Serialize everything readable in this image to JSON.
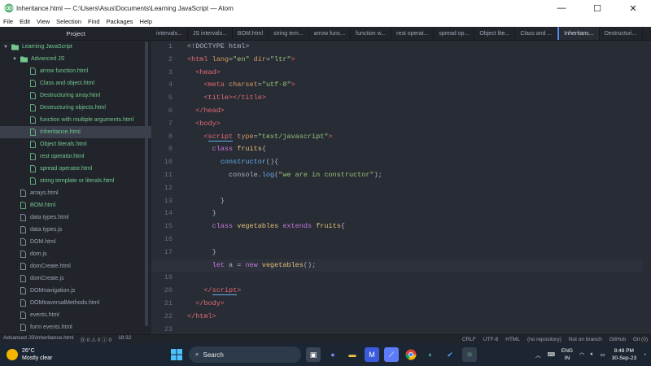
{
  "window": {
    "title": "Inheritance.html — C:\\Users\\Asus\\Documents\\Learning JavaScript — Atom",
    "min": "—",
    "max": "☐",
    "close": "✕"
  },
  "menu": [
    "File",
    "Edit",
    "View",
    "Selection",
    "Find",
    "Packages",
    "Help"
  ],
  "project": {
    "header": "Project",
    "root": "Learning JavaScript",
    "folder": "Advanced JS",
    "folder_files": [
      "arrow function.html",
      "Class and object.html",
      "Destructuring array.html",
      "Destructuring objects.html",
      "function with multiple arguments.html",
      "Inheritance.html",
      "Object literals.html",
      "rest operator.html",
      "spread operator.html",
      "string template or literals.html"
    ],
    "files": [
      "arrays.html",
      "BOM.html",
      "data types.html",
      "data types.js",
      "DOM.html",
      "dom.js",
      "domCreate.html",
      "domCreate.js",
      "DOMnavigation.js",
      "DOMtraversalMethods.html",
      "events.html",
      "form events.html"
    ]
  },
  "tabs": [
    "intervals...",
    "JS intervals...",
    "BOM.html",
    "string tem...",
    "arrow func...",
    "function w...",
    "rest operat...",
    "spread op...",
    "Object lite...",
    "Class and ...",
    "Inheritanc...",
    "Destructuri..."
  ],
  "active_tab": "Inheritanc...",
  "editor": {
    "line_numbers": [
      "1",
      "2",
      "3",
      "4",
      "5",
      "6",
      "7",
      "8",
      "9",
      "10",
      "11",
      "12",
      "13",
      "14",
      "15",
      "16",
      "17",
      "18",
      "19",
      "20",
      "21",
      "22",
      "23"
    ],
    "current_line": "18"
  },
  "status": {
    "path": "Advanced JS\\Inheritance.html",
    "counts": "⓪ 0 ⚠ 0 ⓘ 0",
    "cursor": "18:32",
    "crlf": "CRLF",
    "encoding": "UTF-8",
    "grammar": "HTML",
    "repo": "(no repository)",
    "branch": "Not on branch",
    "github": "GitHub",
    "git": "Git (0)"
  },
  "taskbar": {
    "temp": "26°C",
    "weather": "Mostly clear",
    "search": "Search",
    "lang1": "ENG",
    "lang2": "IN",
    "time": "8:48 PM",
    "date": "30-Sep-23"
  }
}
